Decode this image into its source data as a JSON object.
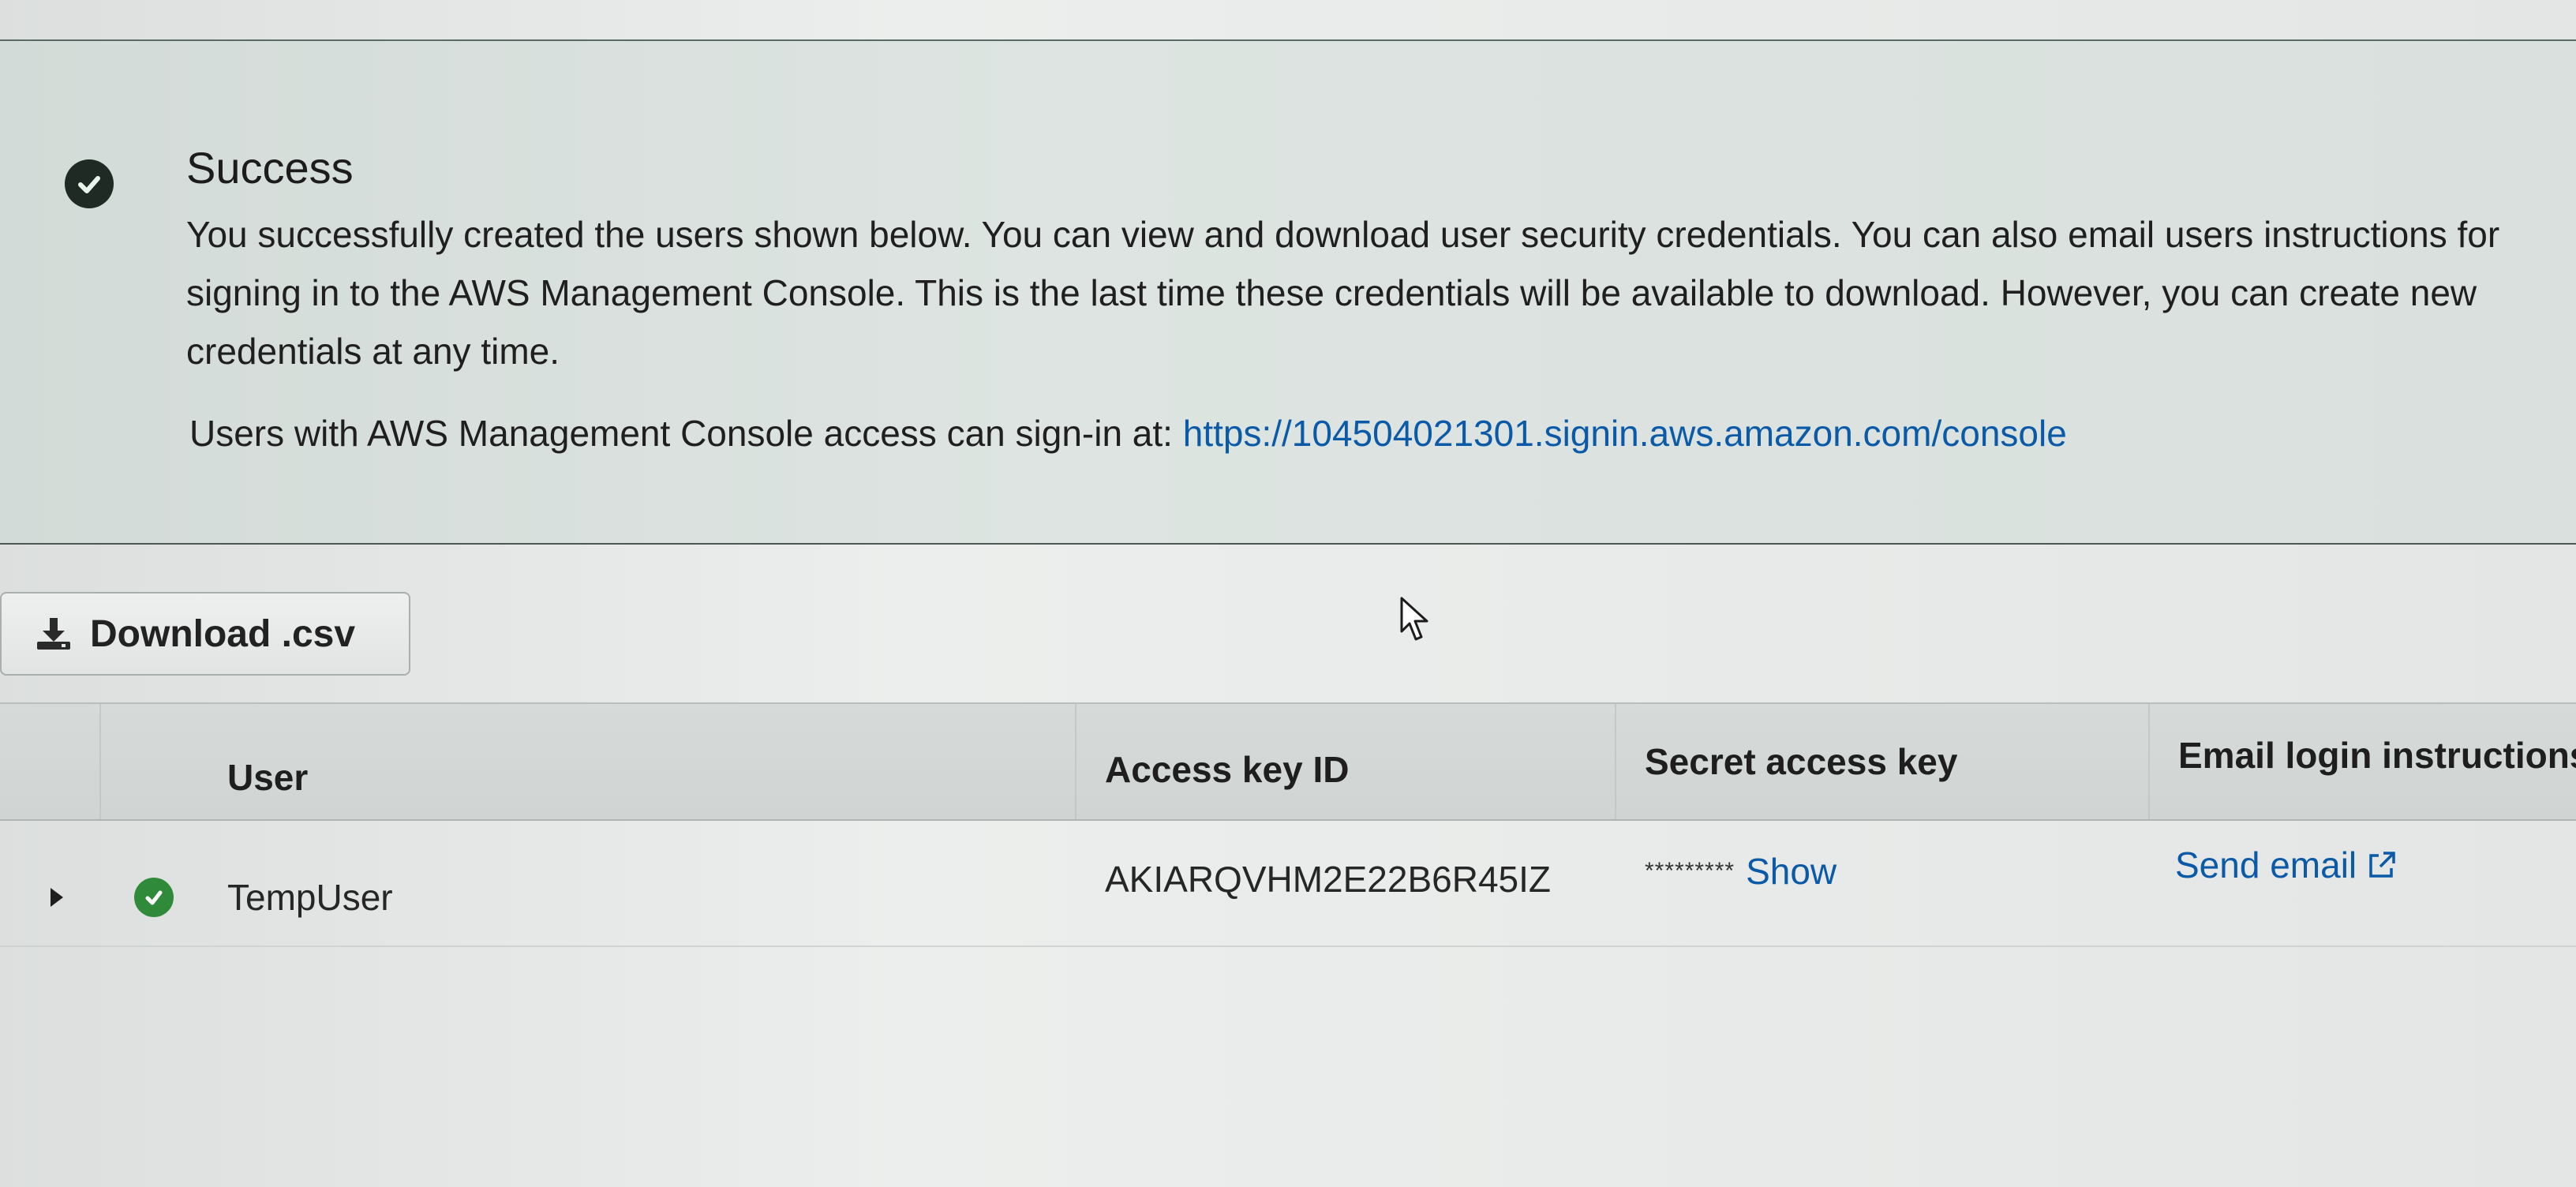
{
  "banner": {
    "icon": "check-circle-icon",
    "title": "Success",
    "body": "You successfully created the users shown below. You can view and download user security credentials. You can also email users instructions for signing in to the AWS Management Console. This is the last time these credentials will be available to download. However, you can create new credentials at any time.",
    "signin_prefix": "Users with AWS Management Console access can sign-in at:",
    "signin_url": "https://104504021301.signin.aws.amazon.com/console"
  },
  "toolbar": {
    "download_label": "Download .csv",
    "download_icon": "download-icon"
  },
  "table": {
    "columns": [
      "",
      "",
      "User",
      "Access key ID",
      "Secret access key",
      "Email login instructions"
    ],
    "rows": [
      {
        "status_icon": "check-circle-icon",
        "user": "TempUser",
        "access_key_id": "AKIARQVHM2E22B6R45IZ",
        "secret_masked": "*********",
        "secret_action": "Show",
        "email_action": "Send email",
        "email_icon": "external-link-icon"
      }
    ]
  },
  "colors": {
    "link": "#0a5aa8",
    "success_green": "#2f8a3a",
    "banner_bg": "#d9e0dd"
  }
}
